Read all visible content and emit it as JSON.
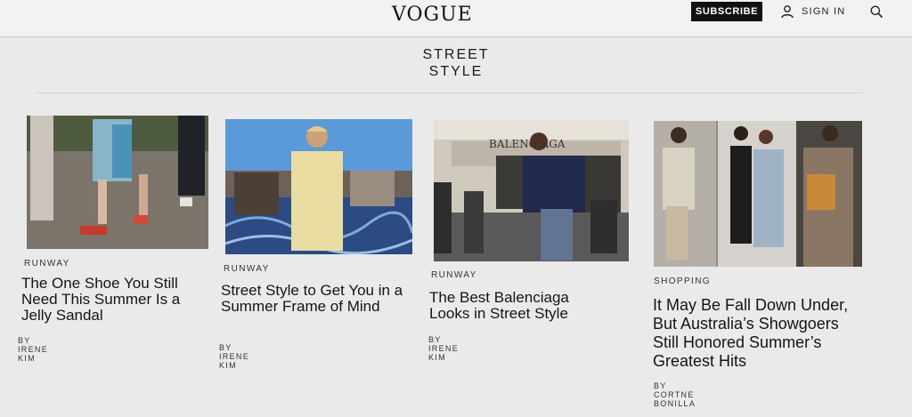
{
  "header": {
    "logo": "VOGUE",
    "subscribe_label": "SUBSCRIBE",
    "signin_label": "SIGN IN"
  },
  "section": {
    "title_line1": "STREET",
    "title_line2": "STYLE"
  },
  "cards": [
    {
      "rubric": "RUNWAY",
      "headline": "The One Shoe You Still Need This Summer Is a Jelly Sandal",
      "byline": "BY IRENE KIM"
    },
    {
      "rubric": "RUNWAY",
      "headline": "Street Style to Get You in a Summer Frame of Mind",
      "byline": "BY IRENE KIM"
    },
    {
      "rubric": "RUNWAY",
      "headline": "The Best Balenciaga Looks in Street Style",
      "byline": "BY IRENE KIM",
      "photo_sign": "BALENCIAGA"
    },
    {
      "rubric": "SHOPPING",
      "headline": "It May Be Fall Down Under, But Australia’s Showgoers Still Honored Summer’s Greatest Hits",
      "byline": "BY CORTNE BONILLA"
    }
  ]
}
